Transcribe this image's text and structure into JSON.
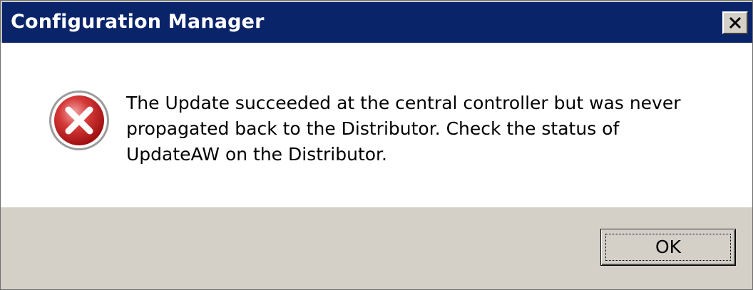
{
  "window": {
    "title": "Configuration Manager",
    "close_symbol": "×"
  },
  "message": {
    "icon": "error-icon",
    "text": "The Update succeeded at the central controller but was never\npropagated back to the Distributor. Check the status of\nUpdateAW on the Distributor."
  },
  "buttons": {
    "ok_label": "OK"
  },
  "colors": {
    "titlebar": "#0a246a",
    "footer": "#d4d0c8",
    "error_red": "#c8102e"
  }
}
